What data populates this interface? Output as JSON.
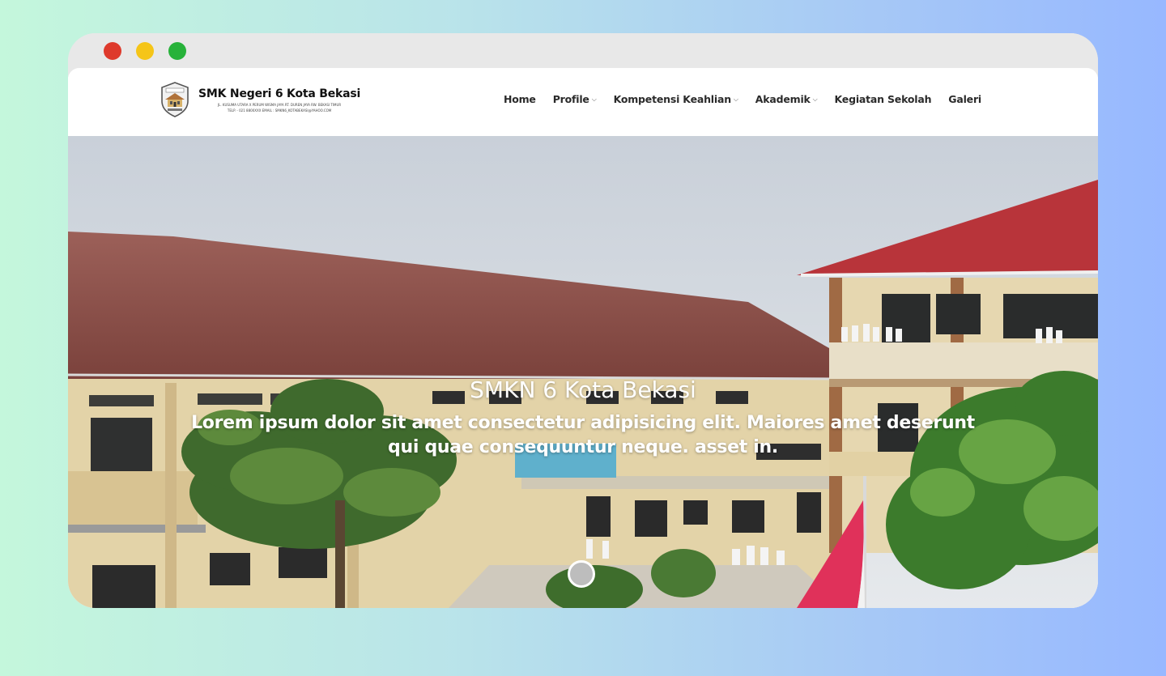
{
  "window": {
    "controls": [
      "close",
      "minimize",
      "maximize"
    ]
  },
  "brand": {
    "name": "SMK Negeri 6 Kota Bekasi",
    "address_line1": "JL. KUSUMA UTARA X PERUM WISMA JAYA RT. DUREN JAYA RW. BEKASI TIMUR",
    "address_line2": "TELP. - 021 8800XXX EMAIL : SMKN6_KOTABEKASI@YAHOO.COM",
    "logo_icon": "school-crest-icon"
  },
  "nav": {
    "items": [
      {
        "label": "Home",
        "dropdown": false
      },
      {
        "label": "Profile",
        "dropdown": true
      },
      {
        "label": "Kompetensi Keahlian",
        "dropdown": true
      },
      {
        "label": "Akademik",
        "dropdown": true
      },
      {
        "label": "Kegiatan Sekolah",
        "dropdown": false
      },
      {
        "label": "Galeri",
        "dropdown": false
      }
    ],
    "caret": "⌵"
  },
  "hero": {
    "title": "SMKN 6 Kota Bekasi",
    "subtitle": "Lorem ipsum dolor sit amet consectetur adipisicing elit. Maiores amet deserunt qui quae consequuntur neque. asset in.",
    "slide_count": 1,
    "active_slide": 1
  },
  "colors": {
    "close": "#de3a2c",
    "minimize": "#f5c518",
    "maximize": "#27b23a",
    "roof": "#8c4a44",
    "roof_red": "#b8343a"
  }
}
